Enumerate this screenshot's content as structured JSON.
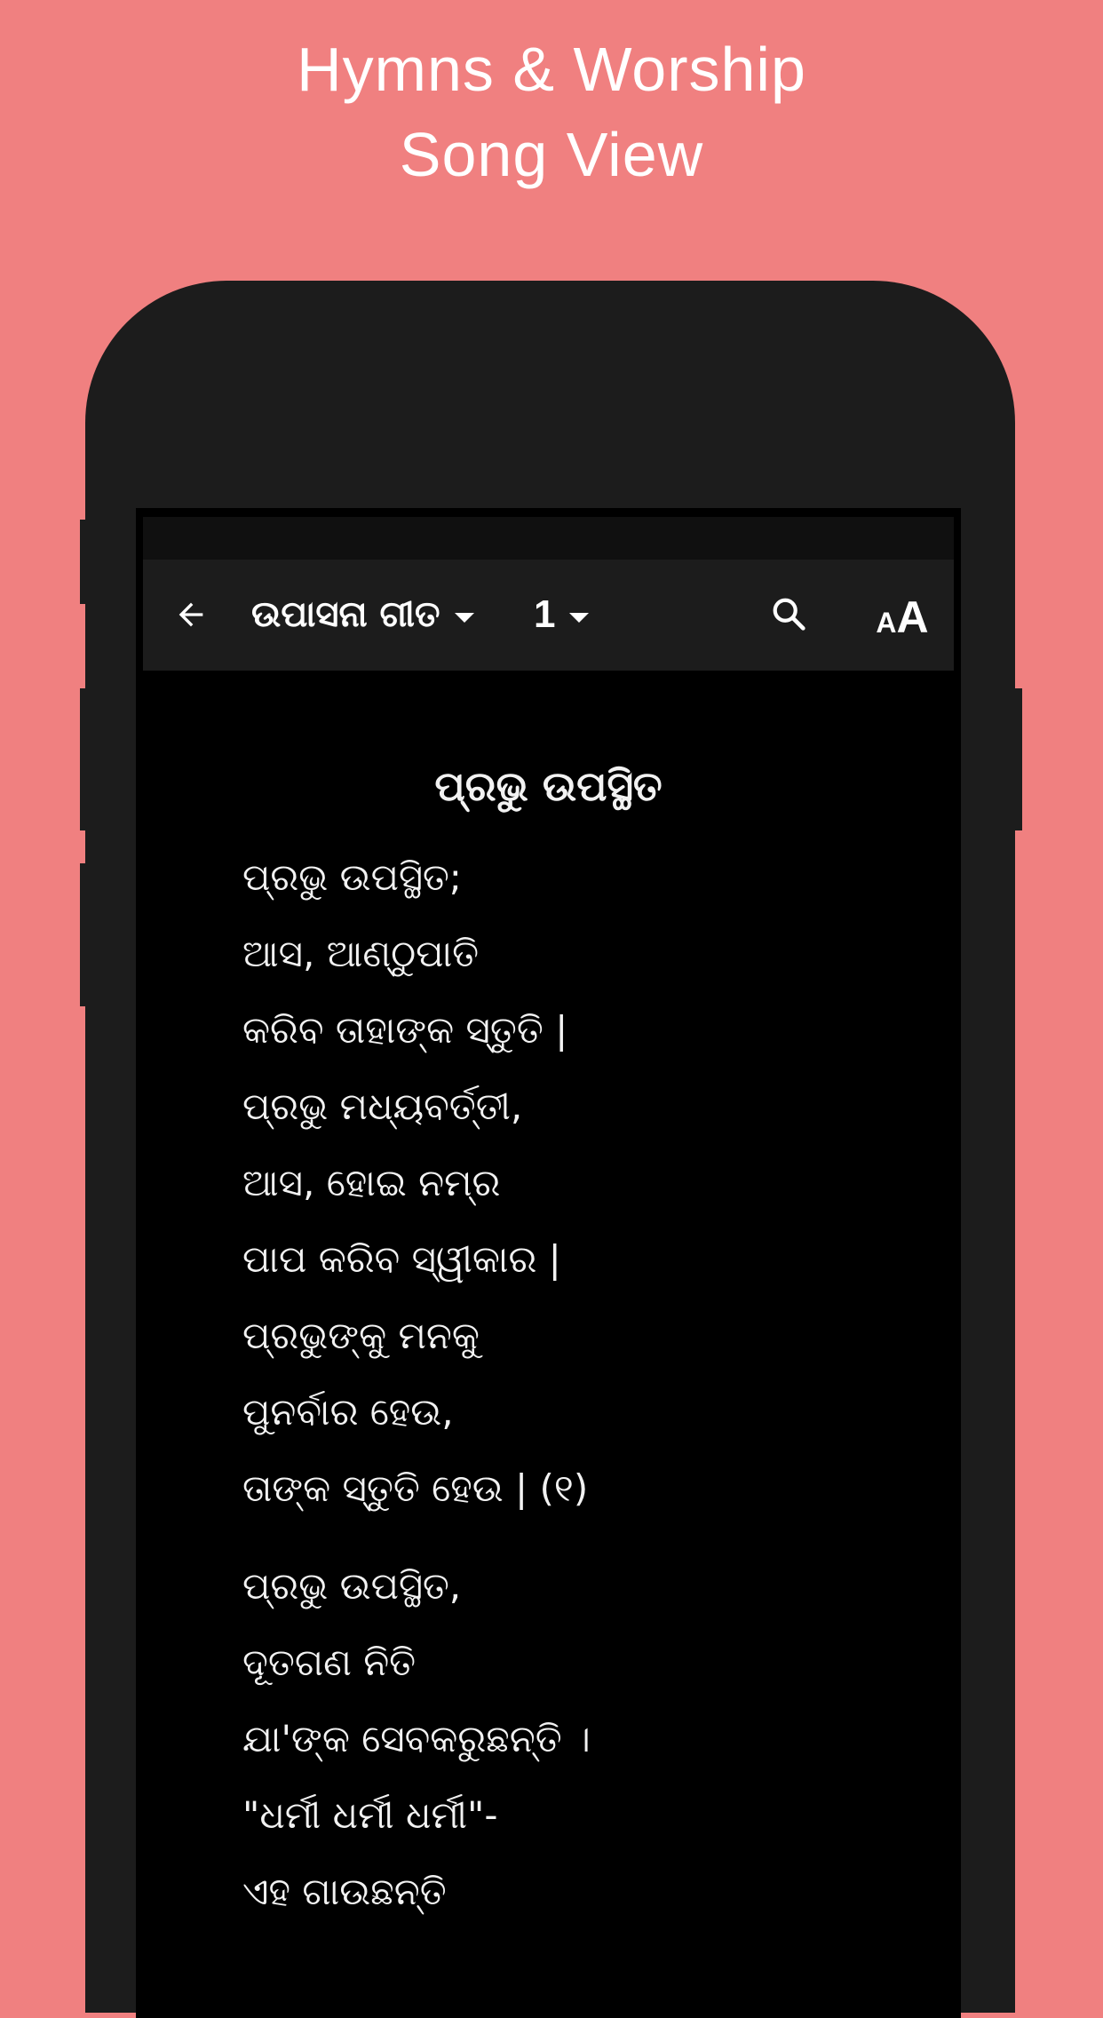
{
  "promo": {
    "title_line1": "Hymns & Worship",
    "title_line2": "Song View"
  },
  "colors": {
    "background": "#F08080",
    "phone_body": "#1C1C1C",
    "toolbar": "#1C1C1C",
    "status_bar": "#101010",
    "screen": "#000000",
    "text": "#FFFFFF"
  },
  "toolbar": {
    "back_icon": "arrow-left",
    "book_select": {
      "label": "ଉପାସନା ଗୀତ",
      "icon": "caret-down"
    },
    "number_select": {
      "label": "1",
      "icon": "caret-down"
    },
    "search_icon": "magnifier",
    "font_size_icon": "text-size",
    "font_size_small": "A",
    "font_size_large": "A"
  },
  "song": {
    "title": "ପ୍ରଭୁ ଉପସ୍ଥିତ",
    "stanzas": [
      {
        "lines": [
          "ପ୍ରଭୁ ଉପସ୍ଥିତ;",
          "ଆସ, ଆଣ୍ଠୁପାତି",
          "କରିବ ତାହାଙ୍କ ସ୍ତୁତି |",
          "ପ୍ରଭୁ ମଧ୍ୟବର୍ତ୍ତୀ,",
          "ଆସ, ହୋଇ ନମ୍ର",
          "ପାପ କରିବ ସ୍ୱୀକାର |",
          "ପ୍ରଭୁଙ୍କୁ ମନକୁ",
          "ପୁନର୍ବାର ହେଉ,",
          "ତାଙ୍କ ସ୍ତୁତି ହେଉ | (୧)"
        ]
      },
      {
        "lines": [
          "ପ୍ରଭୁ ଉପସ୍ଥିତ,",
          "ଦୂତଗଣ ନିତି",
          "ଯା'ଙ୍କ ସେବକରୁଛନ୍ତି ।",
          "\"ଧର୍ମୀ ଧର୍ମୀ ଧର୍ମୀ\"-",
          "ଏହ ଗାଉଛନ୍ତି"
        ]
      }
    ]
  }
}
